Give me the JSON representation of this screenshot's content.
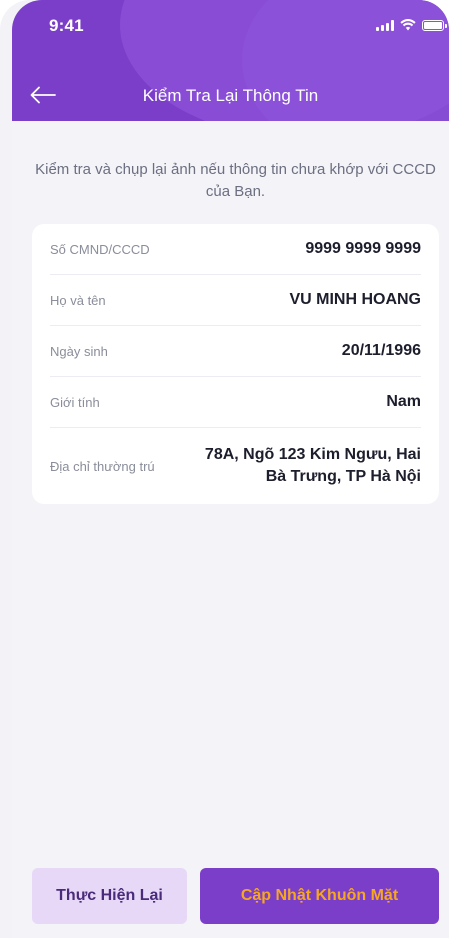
{
  "status_bar": {
    "time": "9:41"
  },
  "nav": {
    "title": "Kiểm Tra Lại Thông Tin"
  },
  "instruction": "Kiểm tra và chụp lại ảnh nếu thông tin chưa khớp với CCCD của Bạn.",
  "info": [
    {
      "label": "Số CMND/CCCD",
      "value": "9999 9999 9999"
    },
    {
      "label": "Họ và tên",
      "value": "VU MINH HOANG"
    },
    {
      "label": "Ngày sinh",
      "value": "20/11/1996"
    },
    {
      "label": "Giới tính",
      "value": "Nam"
    },
    {
      "label": "Địa chỉ thường trú",
      "value": "78A, Ngõ 123 Kim Ngưu, Hai Bà Trưng, TP Hà Nội"
    }
  ],
  "buttons": {
    "retry": "Thực Hiện Lại",
    "update_face": "Cập Nhật Khuôn Mặt"
  },
  "colors": {
    "primary": "#7b3ec8",
    "accent_text": "#f5a623",
    "secondary_bg": "#e7d8f7",
    "background": "#f3f3f8"
  }
}
